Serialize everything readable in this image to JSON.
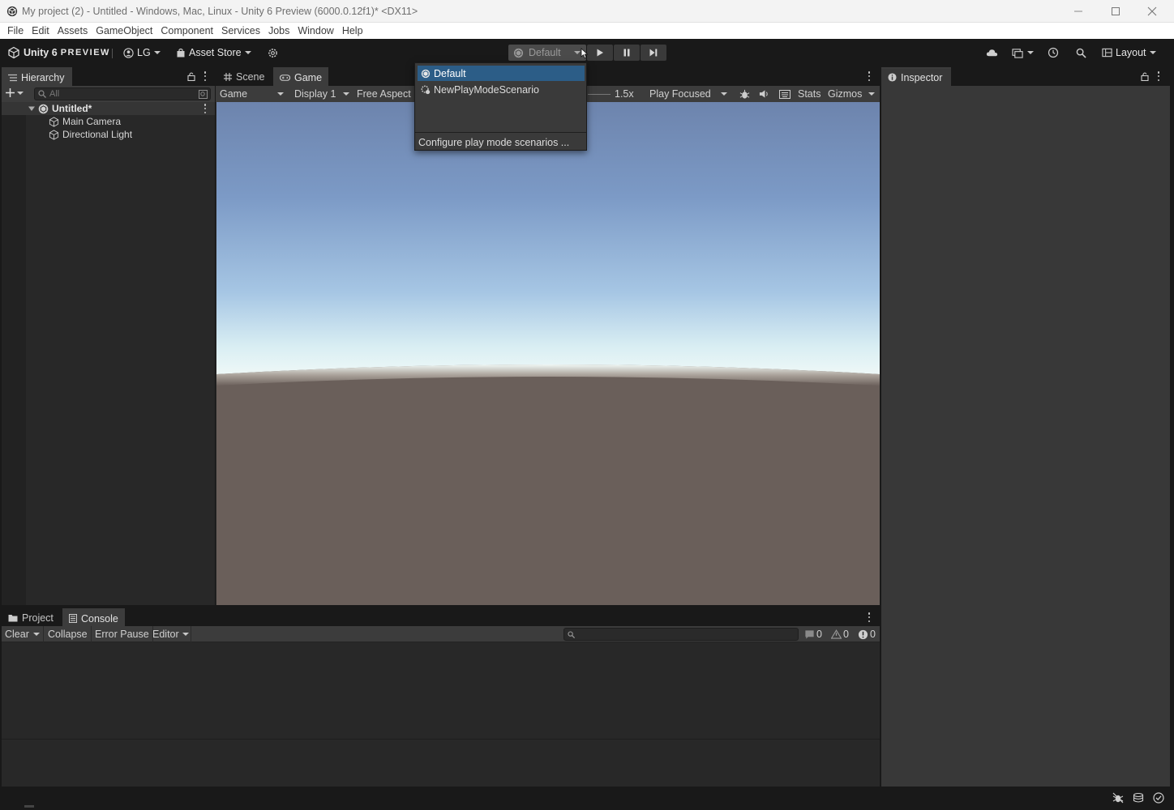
{
  "window": {
    "title": "My project (2) - Untitled - Windows, Mac, Linux - Unity 6 Preview (6000.0.12f1)* <DX11>"
  },
  "menu": [
    "File",
    "Edit",
    "Assets",
    "GameObject",
    "Component",
    "Services",
    "Jobs",
    "Window",
    "Help"
  ],
  "toolbar": {
    "brand": "Unity 6",
    "brand_suffix": "PREVIEW",
    "account": "LG",
    "asset_store": "Asset Store",
    "scenario": "Default",
    "layout": "Layout"
  },
  "hierarchy": {
    "tab": "Hierarchy",
    "search_placeholder": "All",
    "scene": "Untitled*",
    "items": [
      "Main Camera",
      "Directional Light"
    ]
  },
  "game_view": {
    "tabs": [
      "Scene",
      "Game"
    ],
    "view_mode": "Game",
    "display": "Display 1",
    "aspect": "Free Aspect",
    "scale": "1.5x",
    "play_mode": "Play Focused",
    "stats": "Stats",
    "gizmos": "Gizmos"
  },
  "scenario_dropdown": {
    "items": [
      "Default",
      "NewPlayModeScenario"
    ],
    "selected": "Default",
    "configure": "Configure play mode scenarios ..."
  },
  "inspector": {
    "tab": "Inspector"
  },
  "bottom_panel": {
    "tabs": [
      "Project",
      "Console"
    ],
    "clear": "Clear",
    "collapse": "Collapse",
    "error_pause": "Error Pause",
    "editor": "Editor",
    "counts": {
      "logs": "0",
      "warnings": "0",
      "errors": "0"
    }
  },
  "colors": {
    "selection": "#2c5d87",
    "sky_top": "#6d88b2",
    "horizon": "#e9f4f6",
    "ground": "#6a5f5a"
  }
}
